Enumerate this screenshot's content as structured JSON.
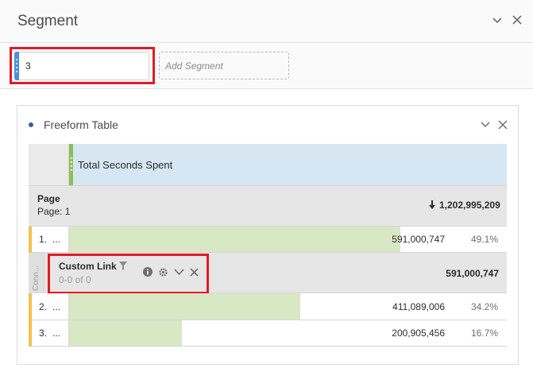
{
  "segment_panel": {
    "title": "Segment",
    "segment_value": "3",
    "add_segment_placeholder": "Add Segment"
  },
  "freeform": {
    "title": "Freeform Table",
    "metric_column": "Total Seconds Spent",
    "dimension": {
      "title": "Page",
      "subtitle": "Page: 1",
      "total": "1,202,995,209"
    },
    "rows": [
      {
        "index": "1.",
        "ellipsis": "...",
        "value": "591,000,747",
        "percent": "49.1%",
        "fraction": 0.491
      },
      {
        "index": "2.",
        "ellipsis": "...",
        "value": "411,089,006",
        "percent": "34.2%",
        "fraction": 0.342
      },
      {
        "index": "3.",
        "ellipsis": "...",
        "value": "200,905,456",
        "percent": "16.7%",
        "fraction": 0.167
      }
    ],
    "breakdown": {
      "side_label": "Conn...",
      "title": "Custom Link",
      "subtitle": "0-0 of 0",
      "total": "591,000,747"
    }
  },
  "icons": {
    "panel_collapse": "chevron-down-icon",
    "panel_close": "close-icon",
    "sort": "arrow-down-icon",
    "filter": "filter-icon",
    "info": "info-icon",
    "settings": "gear-icon"
  },
  "colors": {
    "highlight": "#e01b24",
    "metric_header": "#d6e7f3",
    "bar_fill": "#d8e8c5",
    "row_accent": "#f2c14e",
    "column_handle": "#8cc152",
    "segment_handle": "#4a90d9"
  }
}
